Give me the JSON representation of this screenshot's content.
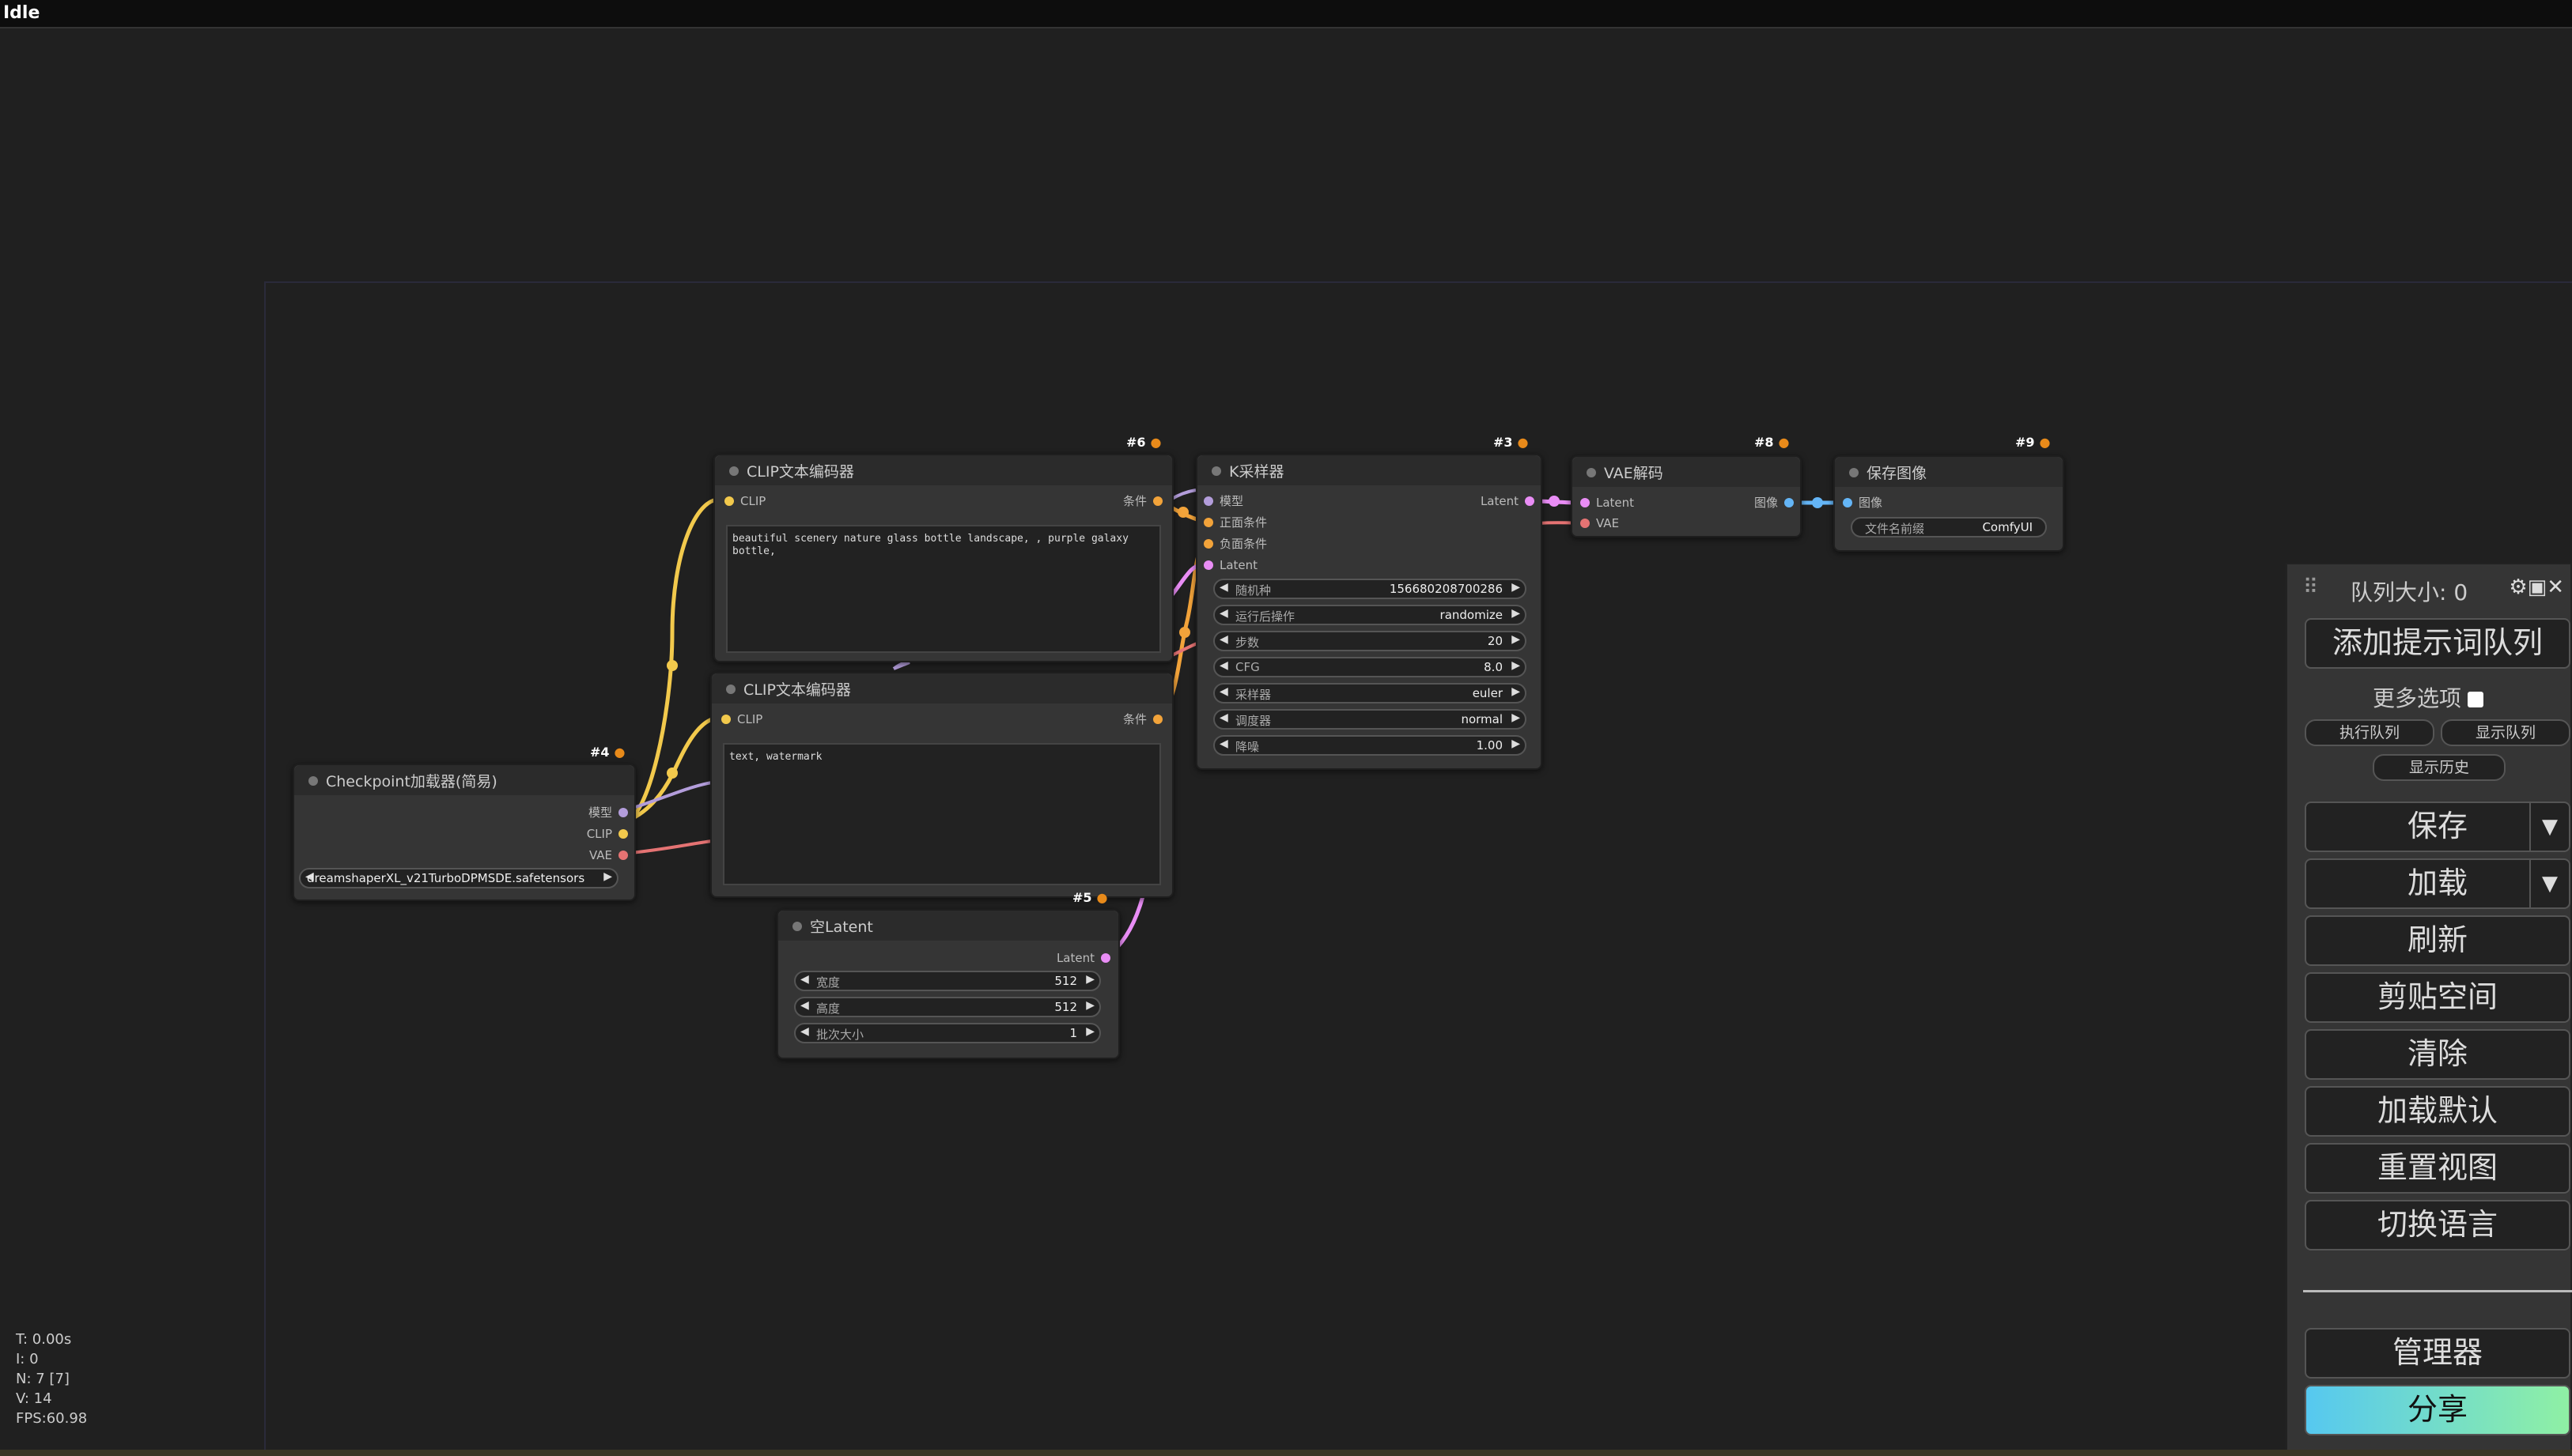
{
  "status": "Idle",
  "nodes": {
    "clip1": {
      "id": "#6",
      "title": "CLIP文本编码器",
      "in_clip": "CLIP",
      "out_cond": "条件",
      "text": "beautiful scenery nature glass bottle landscape, , purple galaxy\nbottle,"
    },
    "clip2": {
      "title": "CLIP文本编码器",
      "in_clip": "CLIP",
      "out_cond": "条件",
      "text": "text, watermark"
    },
    "ksampler": {
      "id": "#3",
      "title": "K采样器",
      "in_model": "模型",
      "in_pos": "正面条件",
      "in_neg": "负面条件",
      "in_latent": "Latent",
      "out_latent": "Latent",
      "widgets": [
        {
          "name": "随机种",
          "value": "156680208700286"
        },
        {
          "name": "运行后操作",
          "value": "randomize"
        },
        {
          "name": "步数",
          "value": "20"
        },
        {
          "name": "CFG",
          "value": "8.0"
        },
        {
          "name": "采样器",
          "value": "euler"
        },
        {
          "name": "调度器",
          "value": "normal"
        },
        {
          "name": "降噪",
          "value": "1.00"
        }
      ]
    },
    "vae": {
      "id": "#8",
      "title": "VAE解码",
      "in_latent": "Latent",
      "in_vae": "VAE",
      "out_image": "图像"
    },
    "save": {
      "id": "#9",
      "title": "保存图像",
      "in_image": "图像",
      "widget_name": "文件名前缀",
      "widget_value": "ComfyUI"
    },
    "checkpoint": {
      "id": "#4",
      "title": "Checkpoint加载器(简易)",
      "out_model": "模型",
      "out_clip": "CLIP",
      "out_vae": "VAE",
      "ckpt": "dreamshaperXL_v21TurboDPMSDE.safetensors"
    },
    "latent": {
      "id": "#5",
      "title": "空Latent",
      "out_latent": "Latent",
      "widgets": [
        {
          "name": "宽度",
          "value": "512"
        },
        {
          "name": "高度",
          "value": "512"
        },
        {
          "name": "批次大小",
          "value": "1"
        }
      ]
    }
  },
  "stats": {
    "t": "T: 0.00s",
    "i": "I: 0",
    "n": "N: 7 [7]",
    "v": "V: 14",
    "fps": "FPS:60.98"
  },
  "panel": {
    "queue_size": "队列大小: 0",
    "add_prompt": "添加提示词队列",
    "more_options": "更多选项",
    "run_queue": "执行队列",
    "show_queue": "显示队列",
    "show_history": "显示历史",
    "save": "保存",
    "load": "加载",
    "refresh": "刷新",
    "clipspace": "剪贴空间",
    "clear": "清除",
    "load_default": "加载默认",
    "reset_view": "重置视图",
    "switch_lang": "切换语言",
    "manager": "管理器",
    "share": "分享"
  },
  "colors": {
    "clip": "#f2c94c",
    "model": "#b39ddb",
    "vae": "#e57373",
    "latent": "#e98df5",
    "image": "#64b5f6",
    "cond": "#f2a33a"
  }
}
